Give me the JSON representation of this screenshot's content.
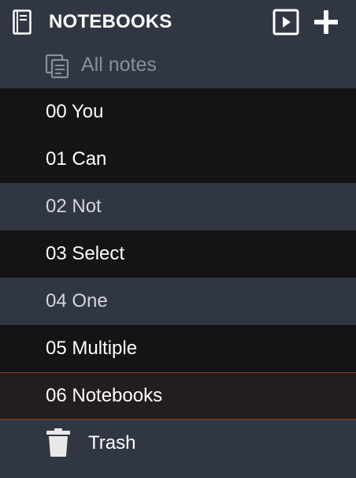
{
  "header": {
    "title": "NOTEBOOKS",
    "icons": {
      "notebook": "book-icon",
      "play": "play-icon",
      "add": "plus-icon"
    }
  },
  "all_notes": {
    "label": "All notes",
    "icon": "notes-icon"
  },
  "notebooks": [
    {
      "label": "00 You",
      "state": "selected"
    },
    {
      "label": "01 Can",
      "state": "selected"
    },
    {
      "label": "02 Not",
      "state": "unselected"
    },
    {
      "label": "03 Select",
      "state": "selected"
    },
    {
      "label": "04 One",
      "state": "unselected"
    },
    {
      "label": "05 Multiple",
      "state": "selected"
    },
    {
      "label": "06 Notebooks",
      "state": "active"
    }
  ],
  "trash": {
    "label": "Trash",
    "icon": "trash-icon"
  },
  "colors": {
    "sidebar_background": "#313742",
    "selected_background": "#141414",
    "active_background": "#231e1d",
    "active_border": "#8a3a24",
    "muted_text": "#8a8f98"
  }
}
